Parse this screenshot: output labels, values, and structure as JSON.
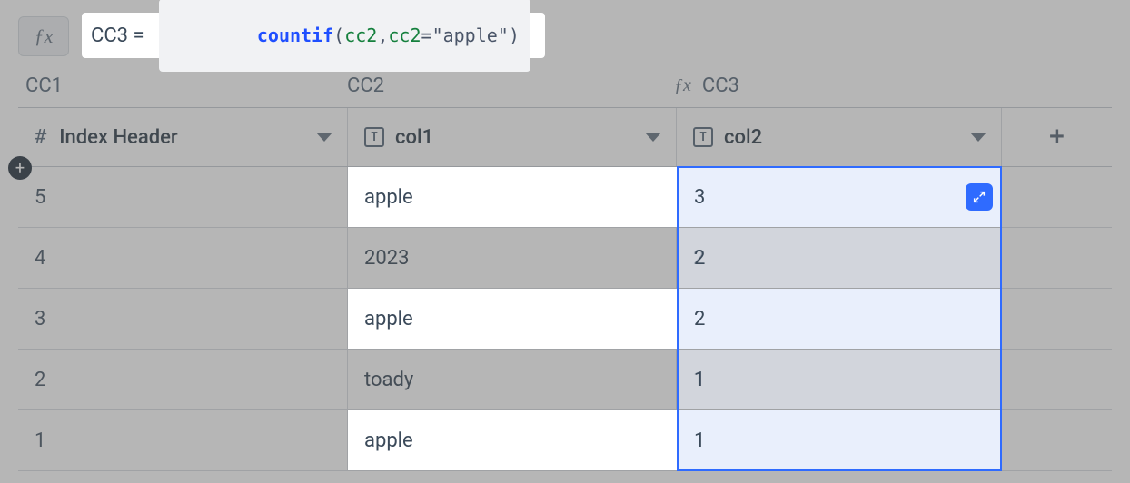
{
  "formula": {
    "fx_label": "ƒx",
    "lhs": "CC3 =",
    "func": "countif",
    "open": "(",
    "ref1": "cc2",
    "comma": ",",
    "ref2": "cc2",
    "eq": "=",
    "str": "\"apple\"",
    "close": ")"
  },
  "col_labels": {
    "c1": "CC1",
    "c2": "CC2",
    "c3": "CC3",
    "fx_mini": "ƒx"
  },
  "headers": {
    "index": "Index Header",
    "hash": "#",
    "col1_type": "T",
    "col1": "col1",
    "col2_type": "T",
    "col2": "col2",
    "plus": "+"
  },
  "rows": [
    {
      "index": "5",
      "col1": "apple",
      "col2": "3"
    },
    {
      "index": "4",
      "col1": "2023",
      "col2": "2"
    },
    {
      "index": "3",
      "col1": "apple",
      "col2": "2"
    },
    {
      "index": "2",
      "col1": "toady",
      "col2": "1"
    },
    {
      "index": "1",
      "col1": "apple",
      "col2": "1"
    }
  ],
  "add_row_badge": "+"
}
